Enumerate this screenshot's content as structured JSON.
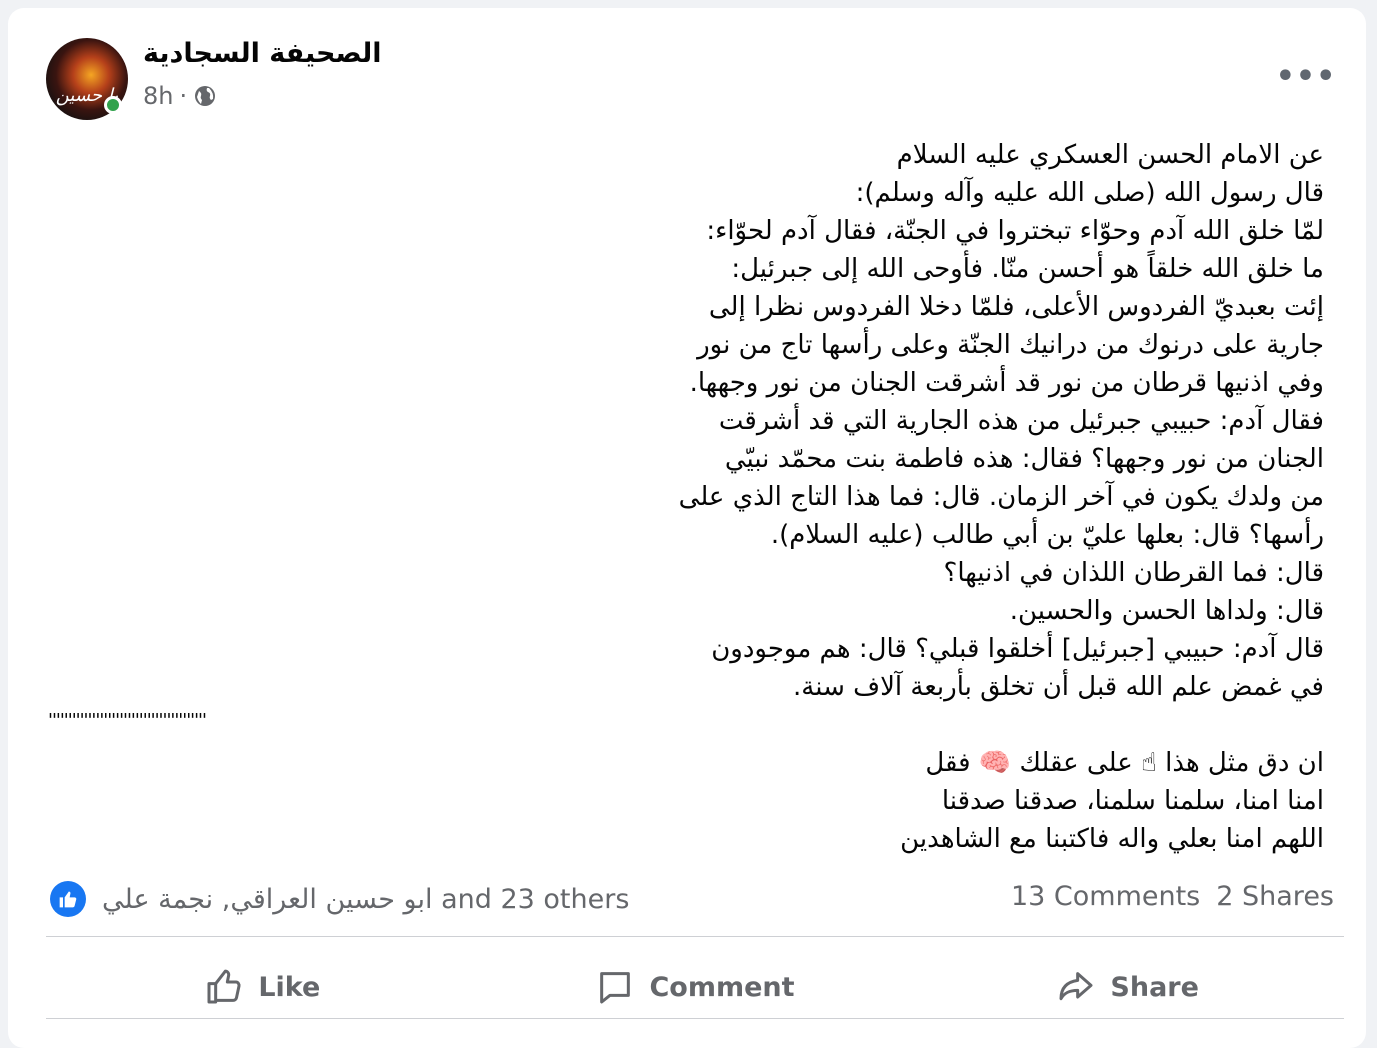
{
  "post": {
    "page_name": "الصحيفة السجادية",
    "time": "8h",
    "dot": "·",
    "avatar_text": "يا حسين",
    "body_lines": [
      "عن الامام الحسن العسكري عليه السلام",
      "قال رسول الله (صلى الله عليه وآله وسلم):",
      "لمّا خلق الله آدم وحوّاء تبختروا في الجنّة، فقال آدم لحوّاء:",
      "ما خلق الله خلقاً هو أحسن منّا. فأوحى الله إلى جبرئيل:",
      "إئت بعبديّ الفردوس الأعلى، فلمّا دخلا الفردوس نظرا إلى",
      "جارية على درنوك من درانيك الجنّة وعلى رأسها تاج من نور",
      "وفي اذنيها قرطان من نور قد أشرقت الجنان من نور وجهها.",
      "فقال آدم: حبيبي جبرئيل من هذه الجارية التي قد أشرقت",
      "الجنان من نور وجهها؟ فقال: هذه فاطمة بنت محمّد نبيّي",
      "من ولدك يكون في آخر الزمان. قال: فما هذا التاج الذي على",
      "رأسها؟ قال: بعلها عليّ بن أبي طالب (عليه السلام).",
      "قال: فما القرطان اللذان في اذنيها؟",
      "قال: ولداها الحسن والحسين.",
      "قال آدم: حبيبي [جبرئيل] أخلقوا قبلي؟ قال: هم موجودون",
      "في غمض علم الله قبل أن تخلق بأربعة آلاف سنة."
    ],
    "separator": "''''''''''''''''''''''''''''''''''''''''",
    "closing_lines": [
      "ان دق مثل هذا ☝ على عقلك 🧠 فقل",
      "امنا امنا، سلمنا سلمنا، صدقنا صدقنا",
      "اللهم امنا بعلي واله فاكتبنا مع الشاهدين"
    ]
  },
  "reactions": {
    "summary": "ابو حسين العراقي, نجمة علي and 23 others",
    "comments": "13 Comments",
    "shares": "2 Shares"
  },
  "actions": {
    "like": "Like",
    "comment": "Comment",
    "share": "Share"
  },
  "colors": {
    "accent": "#1877f2",
    "online": "#31a24c",
    "muted_text": "#65676b"
  },
  "icons": [
    "globe-icon",
    "more-options-icon",
    "like-reaction-icon",
    "thumbs-up-icon",
    "comment-icon",
    "share-icon"
  ]
}
